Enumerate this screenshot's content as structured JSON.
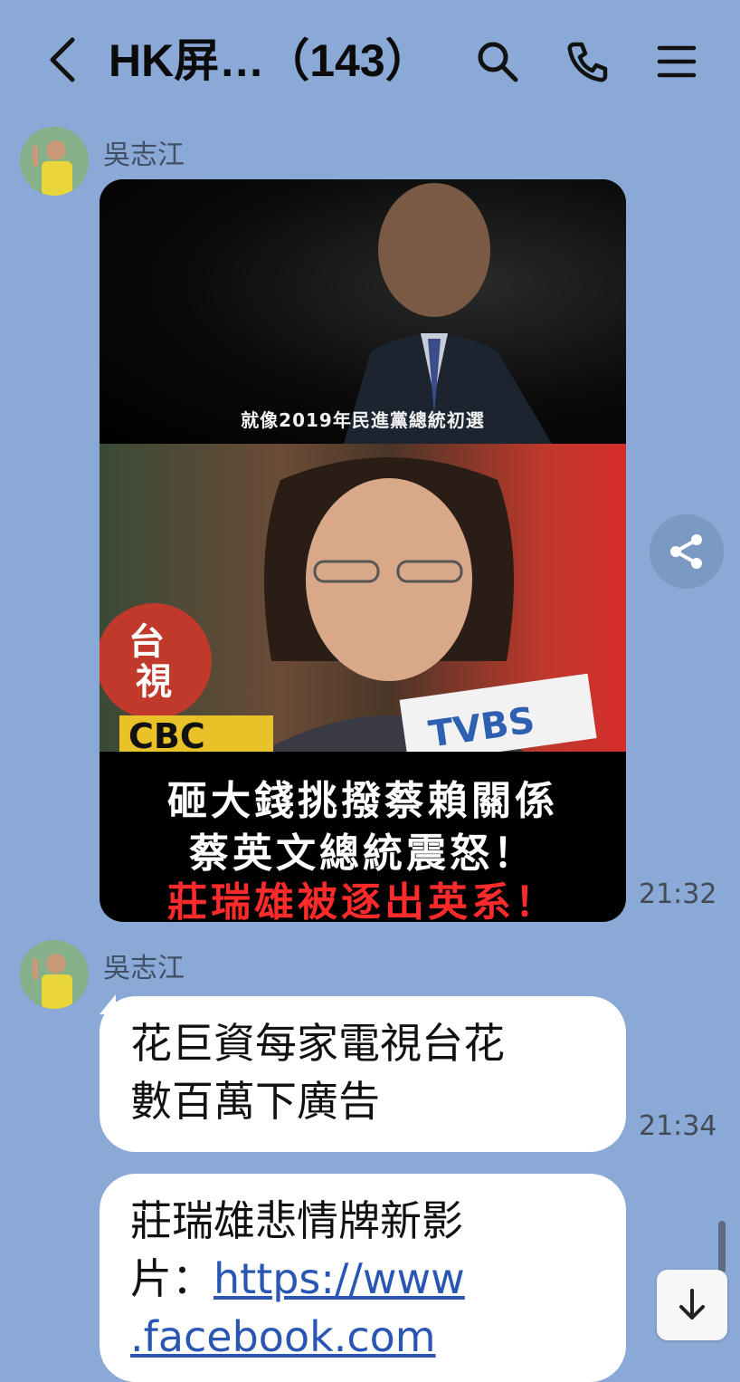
{
  "header": {
    "title": "HK屏…（143）",
    "icons": [
      "back-chevron-icon",
      "search-icon",
      "phone-icon",
      "menu-icon"
    ]
  },
  "messages": [
    {
      "sender": "吳志江",
      "type": "image",
      "image_text": {
        "caption_small": "就像2019年民進黨總統初選",
        "line1": "砸大錢挑撥蔡賴關係",
        "line2": "蔡英文總統震怒！",
        "line3": "莊瑞雄被逐出英系！"
      },
      "time": "21:32"
    },
    {
      "sender": "吳志江",
      "type": "text",
      "line1": "花巨資每家電視台花",
      "line2": "數百萬下廣告",
      "time": "21:34"
    },
    {
      "type": "text",
      "line1": "莊瑞雄悲情牌新影",
      "line2_prefix": "片：",
      "link_part1": "https://www",
      "link_part2": ".facebook.com"
    }
  ],
  "colors": {
    "background": "#8aa9d6",
    "bubble": "#ffffff",
    "link": "#2a56b3",
    "headline_white": "#ffffff",
    "headline_red": "#ff2b2b"
  }
}
